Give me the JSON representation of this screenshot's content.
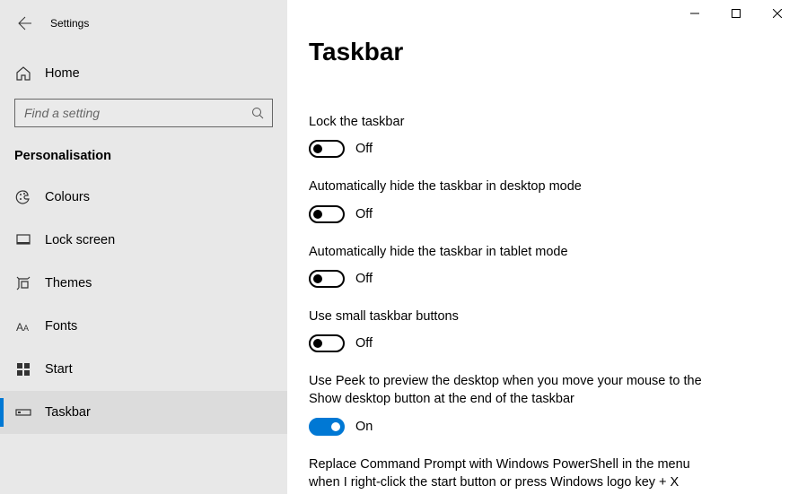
{
  "window": {
    "title": "Settings"
  },
  "sidebar": {
    "home_label": "Home",
    "search_placeholder": "Find a setting",
    "category_title": "Personalisation",
    "items": [
      {
        "label": "Colours"
      },
      {
        "label": "Lock screen"
      },
      {
        "label": "Themes"
      },
      {
        "label": "Fonts"
      },
      {
        "label": "Start"
      },
      {
        "label": "Taskbar"
      }
    ]
  },
  "main": {
    "heading": "Taskbar",
    "settings": [
      {
        "label": "Lock the taskbar",
        "state": "Off",
        "on": false
      },
      {
        "label": "Automatically hide the taskbar in desktop mode",
        "state": "Off",
        "on": false
      },
      {
        "label": "Automatically hide the taskbar in tablet mode",
        "state": "Off",
        "on": false
      },
      {
        "label": "Use small taskbar buttons",
        "state": "Off",
        "on": false
      },
      {
        "label": "Use Peek to preview the desktop when you move your mouse to the Show desktop button at the end of the taskbar",
        "state": "On",
        "on": true
      },
      {
        "label": "Replace Command Prompt with Windows PowerShell in the menu when I right-click the start button or press Windows logo key + X",
        "state": "",
        "on": true
      }
    ]
  }
}
